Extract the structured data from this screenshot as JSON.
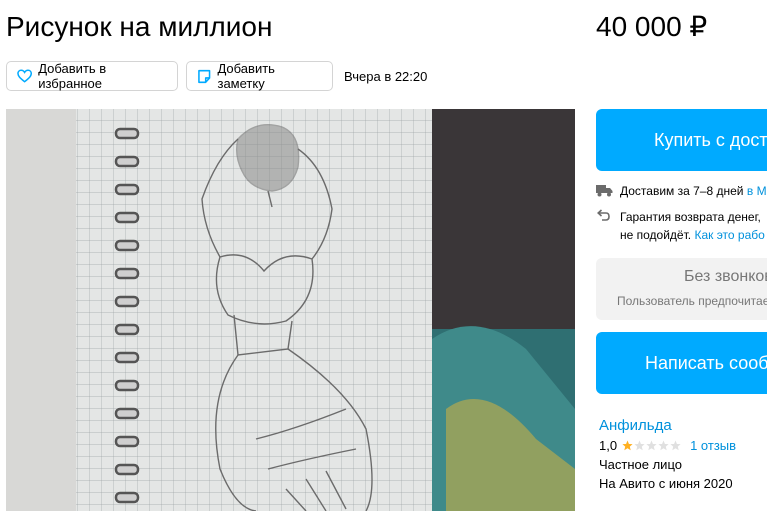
{
  "listing": {
    "title": "Рисунок на миллион",
    "price": "40 000 ₽",
    "posted": "Вчера в 22:20"
  },
  "actions": {
    "favorite_label": "Добавить в избранное",
    "note_label": "Добавить заметку"
  },
  "purchase": {
    "buy_label": "Купить с доставкой",
    "delivery_text": "Доставим за 7–8 дней",
    "delivery_link": "в М",
    "guarantee_line1": "Гарантия возврата денег,",
    "guarantee_line2": "не подойдёт.",
    "guarantee_link": "Как это рабо"
  },
  "contact": {
    "nocall_title": "Без звонков",
    "nocall_sub": "Пользователь предпочитает сообщения",
    "message_label": "Написать сообщение"
  },
  "seller": {
    "name": "Анфильда",
    "rating": "1,0",
    "rating_value": 1,
    "rating_max": 5,
    "reviews": "1 отзыв",
    "type": "Частное лицо",
    "since": "На Авито с июня 2020"
  },
  "colors": {
    "accent": "#00aaff",
    "link": "#0091dc",
    "star_filled": "#ffb021",
    "star_empty": "#e0e0e0"
  },
  "icons": [
    "heart-icon",
    "note-icon",
    "truck-icon",
    "return-icon",
    "star-icon"
  ]
}
